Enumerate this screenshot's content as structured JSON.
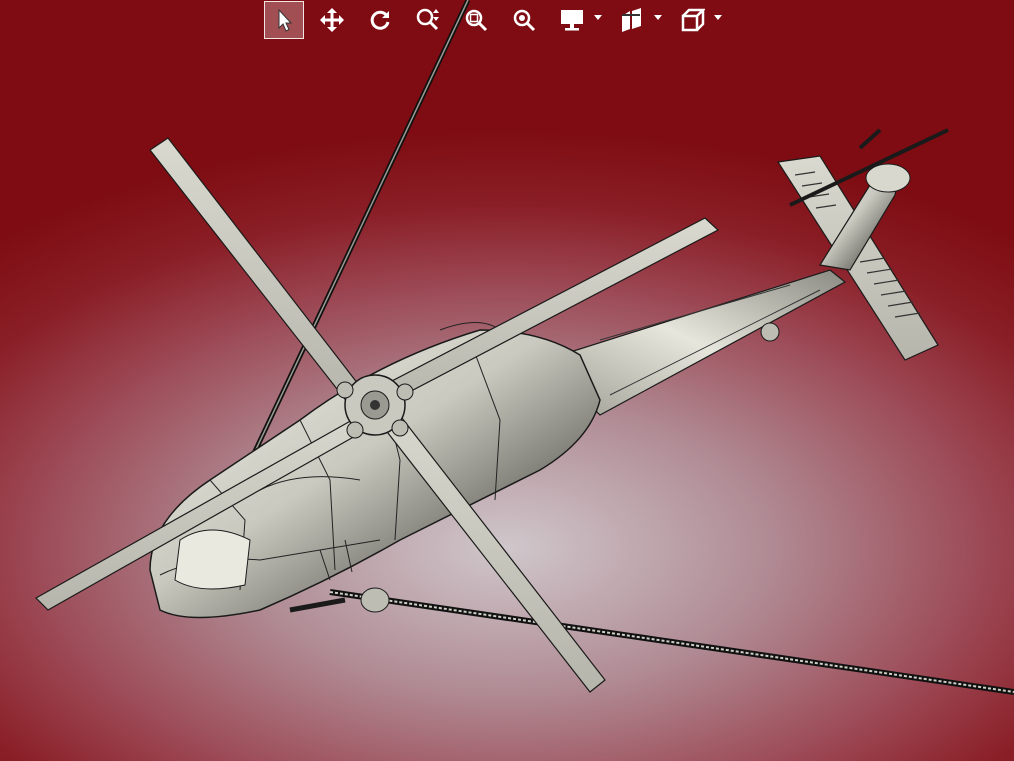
{
  "window": {
    "title": ""
  },
  "toolbar": {
    "buttons": [
      {
        "name": "select-button",
        "icon": "select-arrow-icon",
        "active": true,
        "dropdown": false
      },
      {
        "name": "pan-button",
        "icon": "move-arrows-icon",
        "active": false,
        "dropdown": false
      },
      {
        "name": "rotate-button",
        "icon": "rotate-icon",
        "active": false,
        "dropdown": false
      },
      {
        "name": "zoom-button",
        "icon": "zoom-updown-icon",
        "active": false,
        "dropdown": false
      },
      {
        "name": "zoom-window-button",
        "icon": "zoom-window-icon",
        "active": false,
        "dropdown": false
      },
      {
        "name": "zoom-fit-button",
        "icon": "zoom-fit-icon",
        "active": false,
        "dropdown": false
      },
      {
        "name": "display-mode-button",
        "icon": "monitor-icon",
        "active": false,
        "dropdown": true
      },
      {
        "name": "section-button",
        "icon": "section-plane-icon",
        "active": false,
        "dropdown": true
      },
      {
        "name": "view-orientation-button",
        "icon": "cube-view-icon",
        "active": false,
        "dropdown": true
      }
    ]
  },
  "colors": {
    "background_top": "#7e0c12",
    "background_center": "#cfc7cb",
    "toolbar_icon": "#ffffff",
    "model_metal": "#d2d2c6",
    "model_edge": "#1a1a1a"
  },
  "model": {
    "subject": "helicopter-3d-model"
  }
}
